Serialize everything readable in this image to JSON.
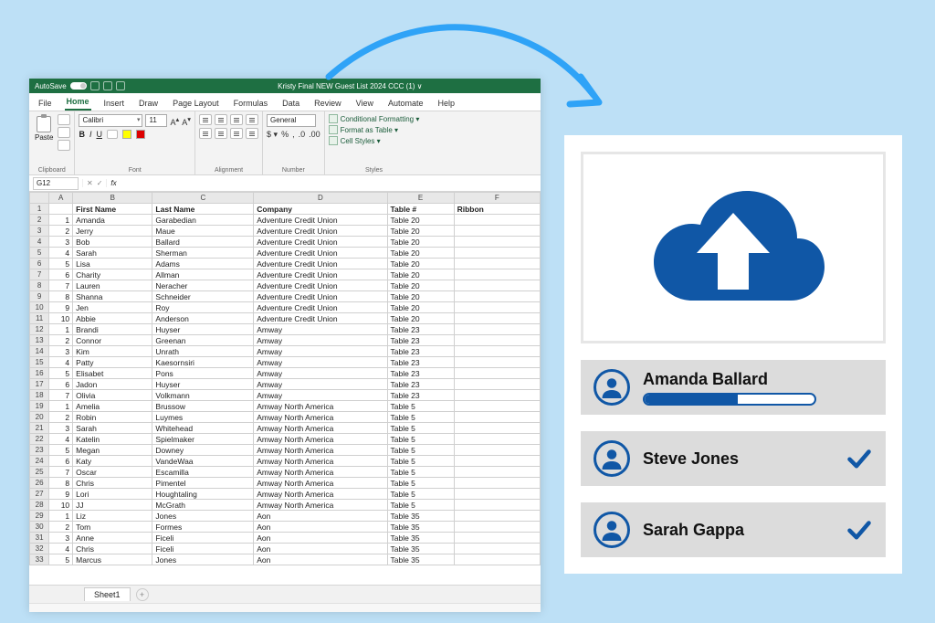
{
  "excel": {
    "titlebar": {
      "autosave_label": "AutoSave",
      "doc_title": "Kristy Final NEW Guest List 2024 CCC (1) ∨"
    },
    "menus": [
      "File",
      "Home",
      "Insert",
      "Draw",
      "Page Layout",
      "Formulas",
      "Data",
      "Review",
      "View",
      "Automate",
      "Help"
    ],
    "active_menu": "Home",
    "ribbon": {
      "clipboard_label": "Clipboard",
      "paste_label": "Paste",
      "font_label": "Font",
      "font_name": "Calibri",
      "font_size": "11",
      "alignment_label": "Alignment",
      "number_label": "Number",
      "number_format": "General",
      "styles_label": "Styles",
      "cond_fmt": "Conditional Formatting ▾",
      "fmt_table": "Format as Table ▾",
      "cell_styles": "Cell Styles ▾"
    },
    "namebox": "G12",
    "columns": [
      "A",
      "B",
      "C",
      "D",
      "E",
      "F"
    ],
    "header_row": [
      "",
      "First Name",
      "Last Name",
      "Company",
      "Table #",
      "Ribbon"
    ],
    "rows": [
      [
        "1",
        "Amanda",
        "Garabedian",
        "Adventure Credit Union",
        "Table 20",
        ""
      ],
      [
        "2",
        "Jerry",
        "Maue",
        "Adventure Credit Union",
        "Table 20",
        ""
      ],
      [
        "3",
        "Bob",
        "Ballard",
        "Adventure Credit Union",
        "Table 20",
        ""
      ],
      [
        "4",
        "Sarah",
        "Sherman",
        "Adventure Credit Union",
        "Table 20",
        ""
      ],
      [
        "5",
        "Lisa",
        "Adams",
        "Adventure Credit Union",
        "Table 20",
        ""
      ],
      [
        "6",
        "Charity",
        "Allman",
        "Adventure Credit Union",
        "Table 20",
        ""
      ],
      [
        "7",
        "Lauren",
        "Neracher",
        "Adventure Credit Union",
        "Table 20",
        ""
      ],
      [
        "8",
        "Shanna",
        "Schneider",
        "Adventure Credit Union",
        "Table 20",
        ""
      ],
      [
        "9",
        "Jen",
        "Roy",
        "Adventure Credit Union",
        "Table 20",
        ""
      ],
      [
        "10",
        "Abbie",
        "Anderson",
        "Adventure Credit Union",
        "Table 20",
        ""
      ],
      [
        "1",
        "Brandi",
        "Huyser",
        "Amway",
        "Table 23",
        ""
      ],
      [
        "2",
        "Connor",
        "Greenan",
        "Amway",
        "Table 23",
        ""
      ],
      [
        "3",
        "Kim",
        "Unrath",
        "Amway",
        "Table 23",
        ""
      ],
      [
        "4",
        "Patty",
        "Kaesornsiri",
        "Amway",
        "Table 23",
        ""
      ],
      [
        "5",
        "Elisabet",
        "Pons",
        "Amway",
        "Table 23",
        ""
      ],
      [
        "6",
        "Jadon",
        "Huyser",
        "Amway",
        "Table 23",
        ""
      ],
      [
        "7",
        "Olivia",
        "Volkmann",
        "Amway",
        "Table 23",
        ""
      ],
      [
        "1",
        "Amelia",
        "Brussow",
        "Amway North America",
        "Table 5",
        ""
      ],
      [
        "2",
        "Robin",
        "Luymes",
        "Amway North America",
        "Table 5",
        ""
      ],
      [
        "3",
        "Sarah",
        "Whitehead",
        "Amway North America",
        "Table 5",
        ""
      ],
      [
        "4",
        "Katelin",
        "Spielmaker",
        "Amway North America",
        "Table 5",
        ""
      ],
      [
        "5",
        "Megan",
        "Downey",
        "Amway North America",
        "Table 5",
        ""
      ],
      [
        "6",
        "Katy",
        "VandeWaa",
        "Amway North America",
        "Table 5",
        ""
      ],
      [
        "7",
        "Oscar",
        "Escamilla",
        "Amway North America",
        "Table 5",
        ""
      ],
      [
        "8",
        "Chris",
        "Pimentel",
        "Amway North America",
        "Table 5",
        ""
      ],
      [
        "9",
        "Lori",
        "Houghtaling",
        "Amway North America",
        "Table 5",
        ""
      ],
      [
        "10",
        "JJ",
        "McGrath",
        "Amway North America",
        "Table 5",
        ""
      ],
      [
        "1",
        "Liz",
        "Jones",
        "Aon",
        "Table 35",
        ""
      ],
      [
        "2",
        "Tom",
        "Formes",
        "Aon",
        "Table 35",
        ""
      ],
      [
        "3",
        "Anne",
        "Ficeli",
        "Aon",
        "Table 35",
        ""
      ],
      [
        "4",
        "Chris",
        "Ficeli",
        "Aon",
        "Table 35",
        ""
      ],
      [
        "5",
        "Marcus",
        "Jones",
        "Aon",
        "Table 35",
        ""
      ]
    ],
    "sheet_tab": "Sheet1"
  },
  "upload": {
    "people": [
      {
        "name": "Amanda Ballard",
        "state": "progress",
        "progress_pct": 55
      },
      {
        "name": "Steve Jones",
        "state": "done"
      },
      {
        "name": "Sarah Gappa",
        "state": "done"
      }
    ]
  },
  "colors": {
    "excel_green": "#1e6f42",
    "brand_blue": "#1057a6",
    "sky_bg": "#bde0f6",
    "arrow_blue": "#2fa3f7"
  }
}
